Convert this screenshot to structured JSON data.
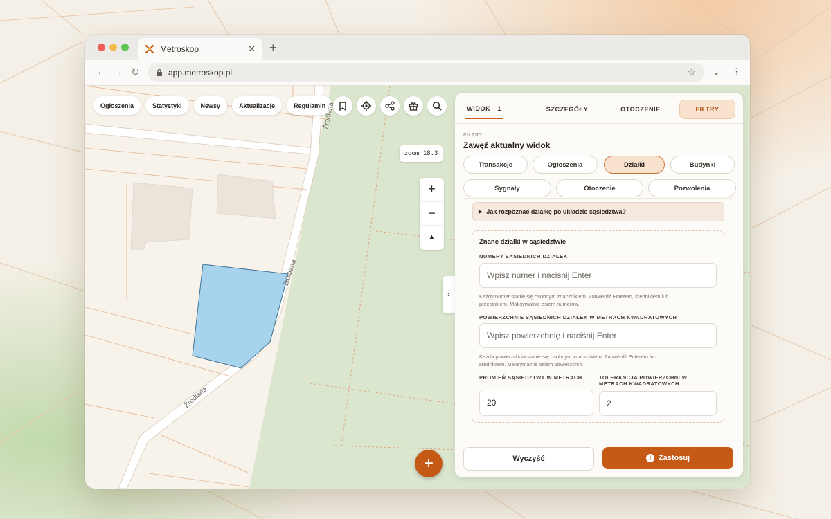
{
  "browser": {
    "tab_title": "Metroskop",
    "url": "app.metroskop.pl"
  },
  "map": {
    "nav": [
      "Ogłoszenia",
      "Statystyki",
      "Newsy",
      "Aktualizacje",
      "Regulamin"
    ],
    "zoom_label": "zoom 18.3",
    "zoom_in": "+",
    "zoom_out": "−",
    "compass": "▲",
    "collapse": "›",
    "fab": "+",
    "streets": [
      "Źródlana",
      "Źródlana",
      "Źródlana"
    ],
    "icons": [
      "bookmark-icon",
      "locate-icon",
      "share-icon",
      "gift-icon",
      "search-icon"
    ]
  },
  "panel": {
    "tabs": {
      "view": "WIDOK",
      "view_count": "1",
      "details": "SZCZEGÓŁY",
      "surroundings": "OTOCZENIE",
      "filters": "FILTRY"
    },
    "section_label": "FILTRY",
    "section_title": "Zawęź aktualny widok",
    "chips_row1": [
      "Transakcje",
      "Ogłoszenia",
      "Działki",
      "Budynki"
    ],
    "chips_row2": [
      "Sygnały",
      "Otoczenie",
      "Pozwolenia"
    ],
    "active_chip": "Działki",
    "accordion": "Jak rozpoznać działkę po układzie sąsiedztwa?",
    "known": {
      "title": "Znane działki w sąsiedztwie",
      "numbers_label": "NUMERY SĄSIEDNICH DZIAŁEK",
      "numbers_placeholder": "Wpisz numer i naciśnij Enter",
      "numbers_hint_1": "Każdy numer stanie się osobnym znacznikiem. Zatwierdź Enterem, średnikiem lub",
      "numbers_hint_2": "przecinkiem. Maksymalnie osiem numerów.",
      "areas_label": "POWIERZCHNIE SĄSIEDNICH DZIAŁEK W METRACH KWADRATOWYCH",
      "areas_placeholder": "Wpisz powierzchnię i naciśnij Enter",
      "areas_hint_1": "Każda powierzchnia stanie się osobnym znacznikiem. Zatwierdź Enterem lub",
      "areas_hint_2": "średnikiem. Maksymalnie osiem powierzchni.",
      "radius_label": "PROMIEŃ SĄSIEDZTWA W METRACH",
      "radius_value": "20",
      "tolerance_label_1": "TOLERANCJA POWIERZCHNI W",
      "tolerance_label_2": "METRACH KWADRATOWYCH",
      "tolerance_value": "2"
    },
    "clear_button": "Wyczyść",
    "apply_button": "Zastosuj",
    "apply_icon": "!"
  },
  "colors": {
    "accent": "#c45a16",
    "parcel_fill": "#a7d3ec",
    "parcel_stroke": "#3f6f93",
    "green_area": "#dbe6cf"
  }
}
